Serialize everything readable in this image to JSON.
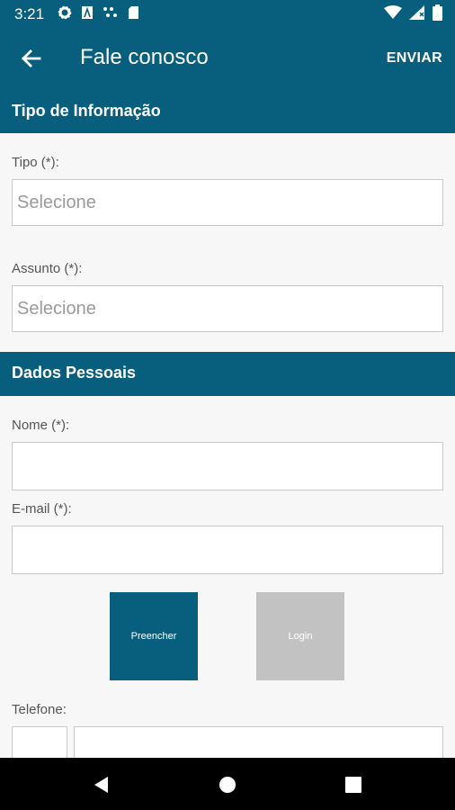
{
  "status_bar": {
    "time": "3:21",
    "icons": [
      "gear-icon",
      "a-icon",
      "dots-icon",
      "sd-card-icon",
      "wifi-icon",
      "signal-icon",
      "battery-icon"
    ]
  },
  "app_bar": {
    "title": "Fale conosco",
    "action": "ENVIAR"
  },
  "section_info": {
    "title": "Tipo de Informação",
    "tipo": {
      "label": "Tipo (*):",
      "placeholder": "Selecione"
    },
    "assunto": {
      "label": "Assunto (*):",
      "placeholder": "Selecione"
    }
  },
  "section_personal": {
    "title": "Dados Pessoais",
    "nome": {
      "label": "Nome (*):",
      "value": ""
    },
    "email": {
      "label": "E-mail (*):",
      "value": ""
    },
    "preencher": "Preencher",
    "login": "Login",
    "telefone": {
      "label": "Telefone:"
    }
  },
  "colors": {
    "primary": "#085f7d",
    "login_button": "#c2c2c2",
    "background": "#f7f7f7"
  },
  "nav_bar": {
    "icons": [
      "back-triangle-icon",
      "home-circle-icon",
      "recents-square-icon"
    ]
  }
}
